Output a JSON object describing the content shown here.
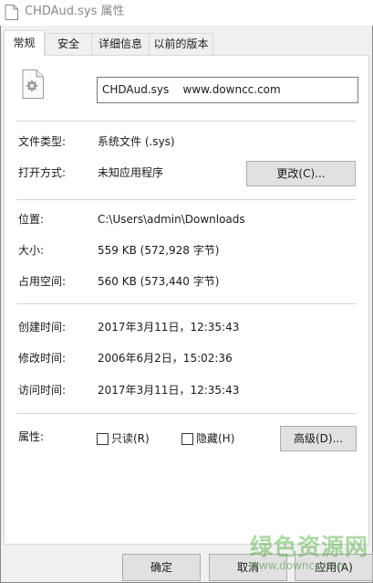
{
  "window": {
    "title": "CHDAud.sys 属性"
  },
  "tabs": [
    {
      "label": "常规",
      "active": true
    },
    {
      "label": "安全",
      "active": false
    },
    {
      "label": "详细信息",
      "active": false
    },
    {
      "label": "以前的版本",
      "active": false
    }
  ],
  "general": {
    "file_name": "CHDAud.sys    www.downcc.com",
    "file_icon": "gear-file-icon",
    "type_label": "文件类型:",
    "type_value": "系统文件 (.sys)",
    "opens_with_label": "打开方式:",
    "opens_with_value": "未知应用程序",
    "change_button": "更改(C)...",
    "location_label": "位置:",
    "location_value": "C:\\Users\\admin\\Downloads",
    "size_label": "大小:",
    "size_value": "559 KB (572,928 字节)",
    "size_on_disk_label": "占用空间:",
    "size_on_disk_value": "560 KB (573,440 字节)",
    "created_label": "创建时间:",
    "created_value": "2017年3月11日，12:35:43",
    "modified_label": "修改时间:",
    "modified_value": "2006年6月2日，15:02:36",
    "accessed_label": "访问时间:",
    "accessed_value": "2017年3月11日，12:35:43",
    "attributes_label": "属性:",
    "readonly_label": "只读(R)",
    "readonly_checked": false,
    "hidden_label": "隐藏(H)",
    "hidden_checked": false,
    "advanced_button": "高级(D)..."
  },
  "footer": {
    "ok": "确定",
    "cancel": "取消",
    "apply": "应用(A)"
  },
  "watermark": {
    "text": "绿色资源网",
    "url": "www.downcc.com"
  }
}
